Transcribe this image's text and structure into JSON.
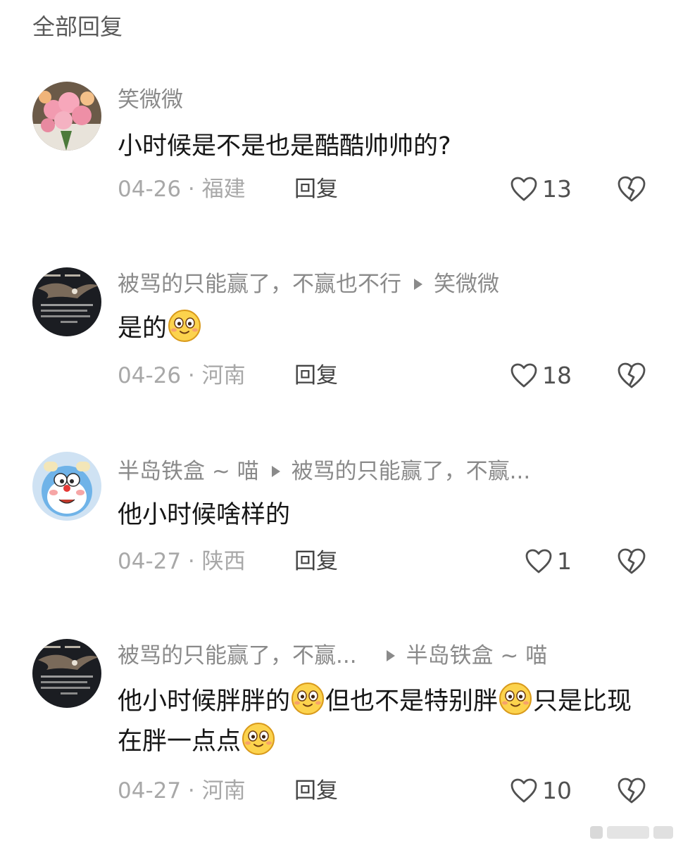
{
  "section_title": "全部回复",
  "comments": [
    {
      "user": "笑微微",
      "reply_to": "",
      "text": "小时候是不是也是酷酷帅帅的?",
      "date_location": "04-26 · 福建",
      "reply_label": "回复",
      "likes": "13",
      "avatar_icon": "flowers-avatar"
    },
    {
      "user": "被骂的只能赢了，不赢也不行",
      "reply_to": "笑微微",
      "text": "是的",
      "date_location": "04-26 · 河南",
      "reply_label": "回复",
      "likes": "18",
      "avatar_icon": "eagle-avatar"
    },
    {
      "user": "半岛铁盒 ~ 喵",
      "reply_to": "被骂的只能赢了，不赢...",
      "text": "他小时候啥样的",
      "date_location": "04-27 · 陕西",
      "reply_label": "回复",
      "likes": "1",
      "avatar_icon": "cartoon-cat-avatar"
    },
    {
      "user": "被骂的只能赢了，不赢...",
      "reply_to": "半岛铁盒 ~ 喵",
      "text_parts": [
        "他小时候胖胖的",
        "但也不是特别胖",
        "只是比现在胖一点点"
      ],
      "date_location": "04-27 · 河南",
      "reply_label": "回复",
      "likes": "10",
      "avatar_icon": "eagle-avatar"
    }
  ],
  "icons": {
    "like": "heart-outline-icon",
    "dislike": "broken-heart-icon",
    "reply_arrow": "triangle-right-icon",
    "emoji": "smiling-face-emoji"
  }
}
